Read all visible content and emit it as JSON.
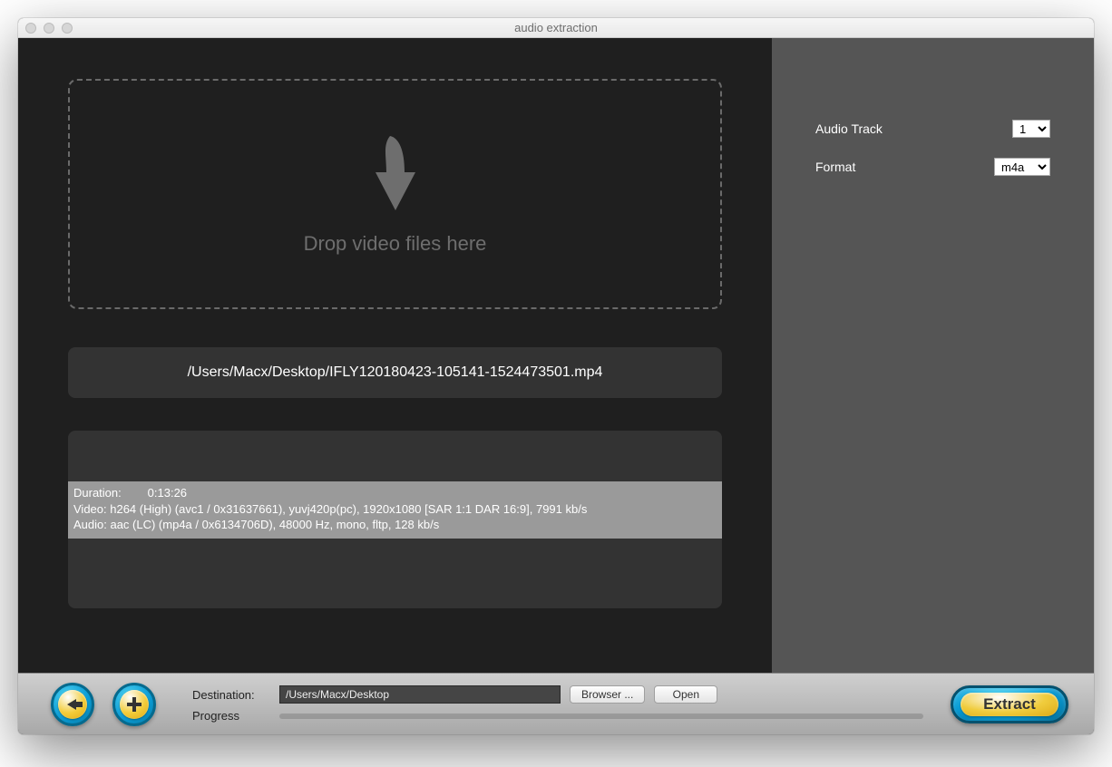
{
  "window": {
    "title": "audio extraction"
  },
  "dropzone": {
    "text": "Drop video files here"
  },
  "file": {
    "path": "/Users/Macx/Desktop/IFLY120180423-105141-1524473501.mp4"
  },
  "info": {
    "duration_label": "Duration:",
    "duration_value": "0:13:26",
    "video_line": "Video: h264 (High) (avc1 / 0x31637661), yuvj420p(pc), 1920x1080 [SAR 1:1 DAR 16:9], 7991 kb/s",
    "audio_line": "Audio: aac (LC) (mp4a / 0x6134706D), 48000 Hz, mono, fltp, 128 kb/s"
  },
  "options": {
    "audio_track_label": "Audio Track",
    "audio_track_value": "1",
    "format_label": "Format",
    "format_value": "m4a"
  },
  "footer": {
    "destination_label": "Destination:",
    "destination_value": "/Users/Macx/Desktop",
    "browser_label": "Browser ...",
    "open_label": "Open",
    "progress_label": "Progress",
    "extract_label": "Extract"
  }
}
